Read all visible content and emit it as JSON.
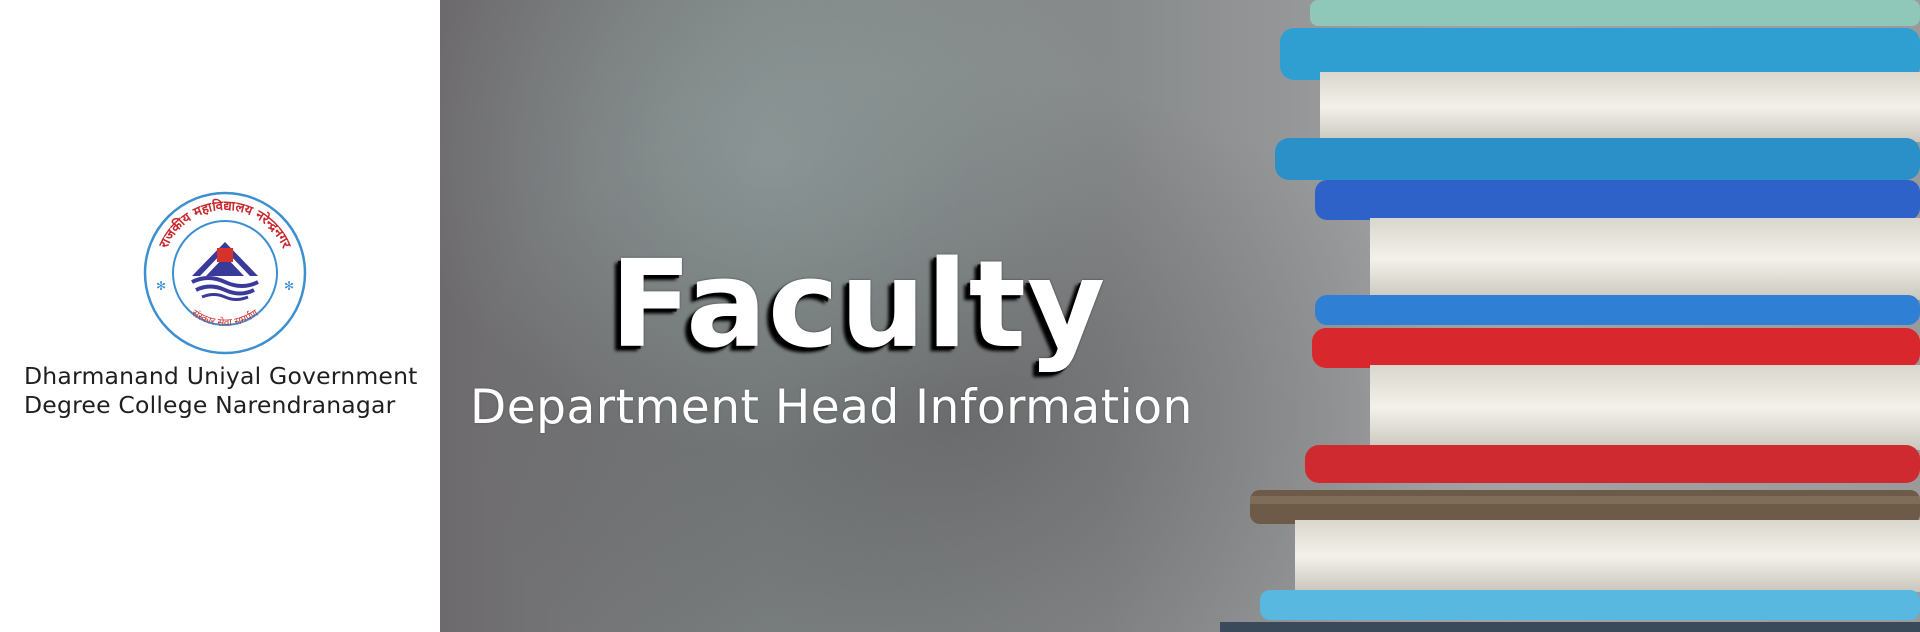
{
  "logo": {
    "seal_top_text": "राजकीय महाविद्यालय नरेन्द्रनगर",
    "seal_bottom_text": "संस्कार सेवा समर्पण",
    "college_name_line1": "Dharmanand Uniyal Government",
    "college_name_line2": "Degree College Narendranagar",
    "colors": {
      "ring": "#3c8fd0",
      "text": "#c8282d",
      "emblem_blue": "#3a3a9a",
      "emblem_red": "#d6312b"
    }
  },
  "hero": {
    "title": "Faculty",
    "subtitle": "Department Head Information"
  },
  "books": {
    "colors": [
      "#8fc7b8",
      "#2f9fd2",
      "#2b90c8",
      "#2e62c8",
      "#2f7fd5",
      "#d8282e",
      "#cf2a2f",
      "#6d5a48",
      "#58b8e0"
    ]
  }
}
